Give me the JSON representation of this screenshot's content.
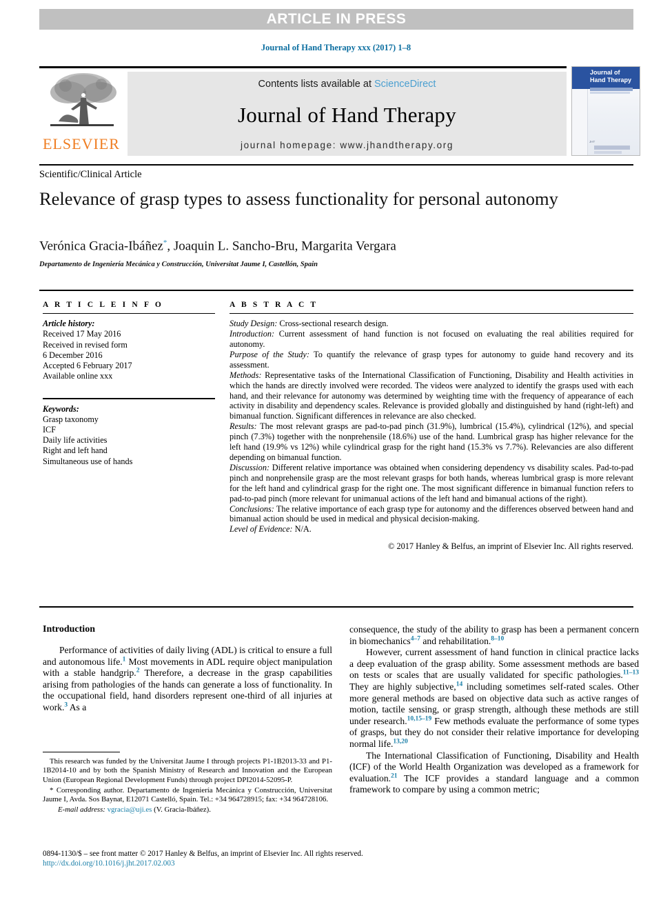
{
  "banner": {
    "text": "ARTICLE IN PRESS"
  },
  "journal_ref": "Journal of Hand Therapy xxx (2017) 1–8",
  "masthead": {
    "contents_prefix": "Contents lists available at ",
    "sciencedirect": "ScienceDirect",
    "journal_title": "Journal of Hand Therapy",
    "homepage": "journal homepage: www.jhandtherapy.org",
    "publisher_logo_text": "ELSEVIER",
    "cover": {
      "title_line1": "Journal of",
      "title_line2": "Hand Therapy",
      "corner_mark": "JHT"
    }
  },
  "article": {
    "kind": "Scientific/Clinical Article",
    "title": "Relevance of grasp types to assess functionality for personal autonomy",
    "authors_part1": "Verónica Gracia-Ibáñez",
    "authors_corresponding_mark": "*",
    "authors_part2": ", Joaquin L. Sancho-Bru, Margarita Vergara",
    "affiliation": "Departamento de Ingeniería Mecánica y Construcción, Universitat Jaume I, Castellón, Spain"
  },
  "article_info": {
    "heading": "A R T I C L E   I N F O",
    "history_label": "Article history:",
    "history_lines": [
      "Received 17 May 2016",
      "Received in revised form",
      "6 December 2016",
      "Accepted 6 February 2017",
      "Available online xxx"
    ],
    "keywords_label": "Keywords:",
    "keywords": [
      "Grasp taxonomy",
      "ICF",
      "Daily life activities",
      "Right and left hand",
      "Simultaneous use of hands"
    ]
  },
  "abstract": {
    "heading": "A B S T R A C T",
    "sections": [
      {
        "label": "Study Design:",
        "text": " Cross-sectional research design."
      },
      {
        "label": "Introduction:",
        "text": " Current assessment of hand function is not focused on evaluating the real abilities required for autonomy."
      },
      {
        "label": "Purpose of the Study:",
        "text": " To quantify the relevance of grasp types for autonomy to guide hand recovery and its assessment."
      },
      {
        "label": "Methods:",
        "text": " Representative tasks of the International Classification of Functioning, Disability and Health activities in which the hands are directly involved were recorded. The videos were analyzed to identify the grasps used with each hand, and their relevance for autonomy was determined by weighting time with the frequency of appearance of each activity in disability and dependency scales. Relevance is provided globally and distinguished by hand (right-left) and bimanual function. Significant differences in relevance are also checked."
      },
      {
        "label": "Results:",
        "text": " The most relevant grasps are pad-to-pad pinch (31.9%), lumbrical (15.4%), cylindrical (12%), and special pinch (7.3%) together with the nonprehensile (18.6%) use of the hand. Lumbrical grasp has higher relevance for the left hand (19.9% vs 12%) while cylindrical grasp for the right hand (15.3% vs 7.7%). Relevancies are also different depending on bimanual function."
      },
      {
        "label": "Discussion:",
        "text": " Different relative importance was obtained when considering dependency vs disability scales. Pad-to-pad pinch and nonprehensile grasp are the most relevant grasps for both hands, whereas lumbrical grasp is more relevant for the left hand and cylindrical grasp for the right one. The most significant difference in bimanual function refers to pad-to-pad pinch (more relevant for unimanual actions of the left hand and bimanual actions of the right)."
      },
      {
        "label": "Conclusions:",
        "text": " The relative importance of each grasp type for autonomy and the differences observed between hand and bimanual action should be used in medical and physical decision-making."
      },
      {
        "label": "Level of Evidence:",
        "text": " N/A."
      }
    ],
    "copyright": "© 2017 Hanley & Belfus, an imprint of Elsevier Inc. All rights reserved."
  },
  "body": {
    "intro_heading": "Introduction",
    "left_paragraph_1_a": "Performance of activities of daily living (ADL) is critical to ensure a full and autonomous life.",
    "left_paragraph_1_ref1": "1",
    "left_paragraph_1_b": " Most movements in ADL require object manipulation with a stable handgrip.",
    "left_paragraph_1_ref2": "2",
    "left_paragraph_1_c": " Therefore, a decrease in the grasp capabilities arising from pathologies of the hands can generate a loss of functionality. In the occupational field, hand disorders represent one-third of all injuries at work.",
    "left_paragraph_1_ref3": "3",
    "left_paragraph_1_d": " As a",
    "right_paragraph_1_a": "consequence, the study of the ability to grasp has been a permanent concern in biomechanics",
    "right_paragraph_1_ref1": "4–7",
    "right_paragraph_1_b": " and rehabilitation.",
    "right_paragraph_1_ref2": "8–10",
    "right_paragraph_2_a": "However, current assessment of hand function in clinical practice lacks a deep evaluation of the grasp ability. Some assessment methods are based on tests or scales that are usually validated for specific pathologies.",
    "right_paragraph_2_ref1": "11–13",
    "right_paragraph_2_b": " They are highly subjective,",
    "right_paragraph_2_ref2": "14",
    "right_paragraph_2_c": " including sometimes self-rated scales. Other more general methods are based on objective data such as active ranges of motion, tactile sensing, or grasp strength, although these methods are still under research.",
    "right_paragraph_2_ref3": "10,15–19",
    "right_paragraph_2_d": " Few methods evaluate the performance of some types of grasps, but they do not consider their relative importance for developing normal life.",
    "right_paragraph_2_ref4": "13,20",
    "right_paragraph_3_a": "The International Classification of Functioning, Disability and Health (ICF) of the World Health Organization was developed as a framework for evaluation.",
    "right_paragraph_3_ref1": "21",
    "right_paragraph_3_b": " The ICF provides a standard language and a common framework to compare by using a common metric;"
  },
  "footnotes": {
    "funding": "This research was funded by the Universitat Jaume I through projects P1-1B2013-33 and P1-1B2014-10 and by both the Spanish Ministry of Research and Innovation and the European Union (European Regional Development Funds) through project DPI2014-52095-P.",
    "corresponding": "* Corresponding author. Departamento de Ingeniería Mecánica y Construcción, Universitat Jaume I, Avda. Sos Baynat, E12071 Castelló, Spain. Tel.: +34 964728915; fax: +34 964728106.",
    "email_label": "E-mail address:",
    "email": "vgracia@uji.es",
    "email_owner": "(V. Gracia-Ibáñez)."
  },
  "footer": {
    "issn_line": "0894-1130/$ – see front matter © 2017 Hanley & Belfus, an imprint of Elsevier Inc. All rights reserved.",
    "doi": "http://dx.doi.org/10.1016/j.jht.2017.02.003"
  },
  "colors": {
    "link_blue": "#1a7fa8",
    "sciencedirect_blue": "#4a9fd0",
    "elsevier_orange": "#ef7d22",
    "banner_gray": "#c0c0c0",
    "masthead_gray": "#e6e6e6",
    "cover_blue": "#2a53a0"
  }
}
